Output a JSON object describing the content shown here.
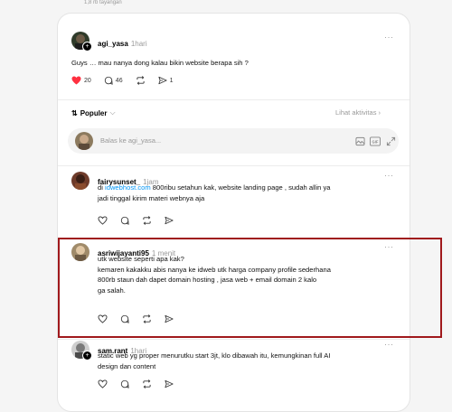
{
  "header": {
    "views": "1,8 rb tayangan"
  },
  "post": {
    "author": "agi_yasa",
    "time": "1hari",
    "text": "Guys … mau nanya dong kalau bikin website berapa sih ?",
    "likes": "20",
    "comments": "46",
    "shares": "1"
  },
  "sort": {
    "label": "Populer",
    "activity": "Lihat aktivitas"
  },
  "reply": {
    "placeholder": "Balas ke agi_yasa..."
  },
  "comments": [
    {
      "author": "fairysunset_",
      "time": "1jam",
      "text_prefix": "di ",
      "link": "idwebhost.com",
      "text_suffix": " 800ribu setahun kak, website landing page , sudah allin ya",
      "line2": "jadi tinggal kirim materi webnya aja"
    },
    {
      "author": "asriwijayanti95",
      "time": "1 menit",
      "lines": [
        "utk website seperti apa kak?",
        "kemaren kakakku abis nanya ke idweb utk harga company profile sederhana",
        "800rb staun dah dapet domain hosting , jasa web + email domain 2 kalo",
        "ga salah."
      ]
    },
    {
      "author": "sam.rant",
      "time": "1hari",
      "lines": [
        "static web yg proper menurutku start 3jt, klo dibawah itu, kemungkinan full AI",
        "design dan content"
      ]
    }
  ],
  "colors": {
    "like": "#ff3040",
    "link": "#0095f6",
    "highlight": "#a0191c"
  }
}
